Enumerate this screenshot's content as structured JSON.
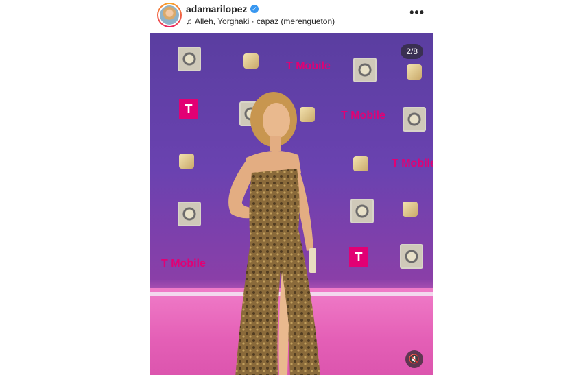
{
  "post": {
    "username": "adamarilopez",
    "verified": true,
    "music": "Alleh, Yorghaki · capaz (merengueton)",
    "slide_counter": "2/8"
  },
  "backdrop": {
    "brand_text": "T Mobile",
    "brand_letter": "T"
  },
  "icons": {
    "verified": "verified-badge-icon",
    "music": "music-note-icon",
    "more": "more-options-icon",
    "mute": "muted-speaker-icon"
  },
  "colors": {
    "brand_magenta": "#e20074",
    "verified_blue": "#3897f0"
  }
}
